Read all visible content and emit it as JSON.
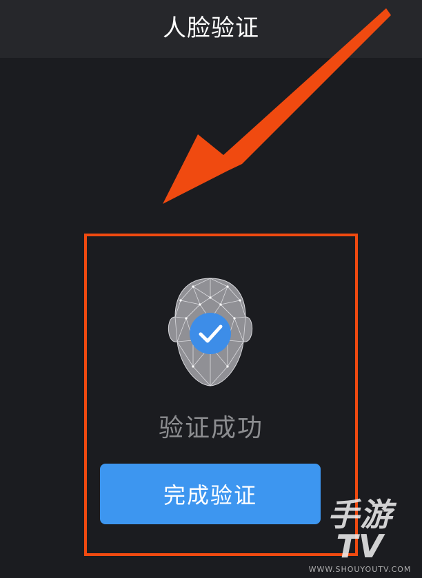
{
  "header": {
    "title": "人脸验证"
  },
  "verification": {
    "status_text": "验证成功",
    "done_button_label": "完成验证"
  },
  "watermark": {
    "logo_text": "手游TV",
    "url_text": "WWW.SHOUYOUTV.COM"
  },
  "icons": {
    "face_scan": "face-mesh-icon",
    "success_check": "check-icon"
  },
  "colors": {
    "background": "#1b1c20",
    "header_background": "#26272b",
    "accent_blue": "#3d96f0",
    "annotation_orange": "#f04a10",
    "status_text": "#8c8d90"
  }
}
